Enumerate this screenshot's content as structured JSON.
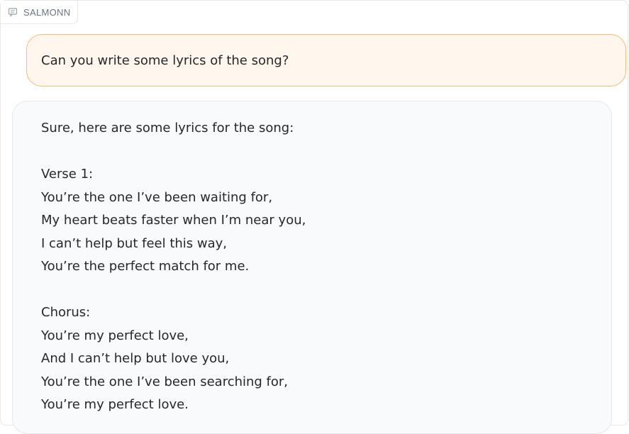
{
  "chatbot": {
    "label": "SALMONN",
    "label_icon": "chat-bubble-icon"
  },
  "messages": {
    "user": "Can you write some lyrics of the song?",
    "bot": {
      "intro": "Sure, here are some lyrics for the song:",
      "verse_title": "Verse 1:",
      "verse_lines": [
        "You’re the one I’ve been waiting for,",
        "My heart beats faster when I’m near you,",
        "I can’t help but feel this way,",
        "You’re the perfect match for me."
      ],
      "chorus_title": "Chorus:",
      "chorus_lines": [
        "You’re my perfect love,",
        "And I can’t help but love you,",
        "You’re the one I’ve been searching for,",
        "You’re my perfect love."
      ]
    }
  },
  "colors": {
    "user_bubble_bg": "#fff7ed",
    "user_bubble_border": "#fdba74",
    "bot_bubble_bg": "#f9fafb",
    "text": "#27272a"
  }
}
